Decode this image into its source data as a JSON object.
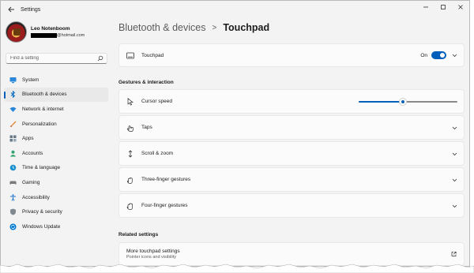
{
  "app": {
    "title": "Settings"
  },
  "window_controls": {
    "minimize": "—",
    "maximize": "□",
    "close": "✕"
  },
  "profile": {
    "name": "Leo Notenboom",
    "email_domain": "@hotmail.com"
  },
  "search": {
    "placeholder": "Find a setting"
  },
  "sidebar": {
    "items": [
      {
        "label": "System",
        "icon": "system-icon",
        "color": "#0078d4"
      },
      {
        "label": "Bluetooth & devices",
        "icon": "bluetooth-icon",
        "color": "#0078d4",
        "active": true
      },
      {
        "label": "Network & internet",
        "icon": "wifi-icon",
        "color": "#0078d4"
      },
      {
        "label": "Personalization",
        "icon": "brush-icon",
        "color": "#e08a3c"
      },
      {
        "label": "Apps",
        "icon": "apps-icon",
        "color": "#5b6b7b"
      },
      {
        "label": "Accounts",
        "icon": "person-icon",
        "color": "#2fa36b"
      },
      {
        "label": "Time & language",
        "icon": "globe-clock-icon",
        "color": "#1a8fd0"
      },
      {
        "label": "Gaming",
        "icon": "gamepad-icon",
        "color": "#6b6b6b"
      },
      {
        "label": "Accessibility",
        "icon": "accessibility-icon",
        "color": "#1a6fc9"
      },
      {
        "label": "Privacy & security",
        "icon": "shield-icon",
        "color": "#6b6b6b"
      },
      {
        "label": "Windows Update",
        "icon": "update-icon",
        "color": "#0078d4"
      }
    ]
  },
  "breadcrumb": {
    "parent": "Bluetooth & devices",
    "separator": ">",
    "current": "Touchpad"
  },
  "touchpad": {
    "label": "Touchpad",
    "state": "On",
    "enabled": true
  },
  "gestures": {
    "heading": "Gestures & interaction",
    "cursor_speed": {
      "label": "Cursor speed",
      "value_fraction": 0.45
    },
    "rows": [
      {
        "label": "Taps",
        "icon": "taps-icon"
      },
      {
        "label": "Scroll & zoom",
        "icon": "scroll-icon"
      },
      {
        "label": "Three-finger gestures",
        "icon": "three-finger-icon"
      },
      {
        "label": "Four-finger gestures",
        "icon": "four-finger-icon"
      }
    ]
  },
  "related": {
    "heading": "Related settings",
    "items": [
      {
        "title": "More touchpad settings",
        "subtitle": "Pointer icons and visibility"
      }
    ]
  },
  "accent_color": "#005fb8"
}
